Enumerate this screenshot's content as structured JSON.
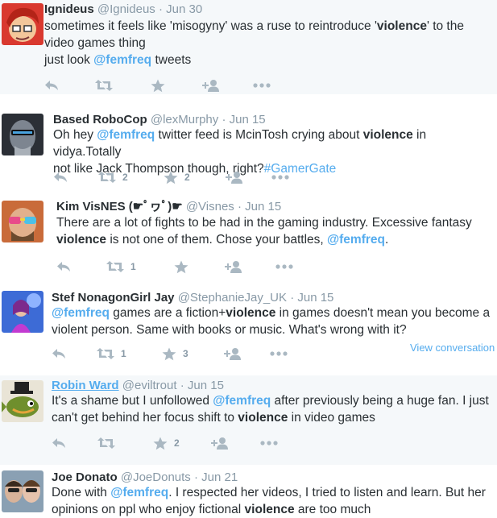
{
  "tweets": [
    {
      "name": "Ignideus",
      "handle": "@Ignideus",
      "date": "Jun 30",
      "lines": [
        [
          {
            "t": "sometimes it feels like 'misogyny' was a ruse to reintroduce '"
          },
          {
            "t": "violence",
            "s": "kw"
          },
          {
            "t": "' to the"
          }
        ],
        [
          {
            "t": "video games thing"
          }
        ],
        [
          {
            "t": "just look "
          },
          {
            "t": "@femfreq",
            "s": "mention"
          },
          {
            "t": " tweets"
          }
        ]
      ],
      "retweets": "",
      "likes": ""
    },
    {
      "name": "Based RoboCop",
      "handle": "@lexMurphy",
      "date": "Jun 15",
      "lines": [
        [
          {
            "t": "Oh hey "
          },
          {
            "t": "@femfreq",
            "s": "mention"
          },
          {
            "t": " twitter feed is McinTosh crying about "
          },
          {
            "t": "violence",
            "s": "kw"
          },
          {
            "t": " in vidya.Totally"
          }
        ],
        [
          {
            "t": "not like Jack Thompson though, right?"
          },
          {
            "t": "#GamerGate",
            "s": "hashtag"
          }
        ]
      ],
      "retweets": "2",
      "likes": "2"
    },
    {
      "name": "Kim VisNES (☛ﾟヮﾟ)☛",
      "handle": "@Visnes",
      "date": "Jun 15",
      "lines": [
        [
          {
            "t": "There are a lot of fights to be had in the gaming industry. Excessive fantasy"
          }
        ],
        [
          {
            "t": "violence",
            "s": "kw"
          },
          {
            "t": " is not one of them. Chose your battles, "
          },
          {
            "t": "@femfreq",
            "s": "mention"
          },
          {
            "t": "."
          }
        ]
      ],
      "retweets": "1",
      "likes": ""
    },
    {
      "name": "Stef NonagonGirl Jay",
      "handle": "@StephanieJay_UK",
      "date": "Jun 15",
      "lines": [
        [
          {
            "t": "@femfreq",
            "s": "mention"
          },
          {
            "t": " games are a fiction+"
          },
          {
            "t": "violence",
            "s": "kw"
          },
          {
            "t": " in games doesn't mean you become a"
          }
        ],
        [
          {
            "t": "violent person. Same with books or music. What's wrong with it?"
          }
        ]
      ],
      "retweets": "1",
      "likes": "3",
      "view_conversation": "View conversation"
    },
    {
      "name": "Robin Ward",
      "handle": "@eviltrout",
      "date": "Jun 15",
      "lines": [
        [
          {
            "t": "It's a shame but I unfollowed "
          },
          {
            "t": "@femfreq",
            "s": "mention"
          },
          {
            "t": " after previously being a huge fan. I just"
          }
        ],
        [
          {
            "t": "can't get behind her focus shift to "
          },
          {
            "t": "violence",
            "s": "kw"
          },
          {
            "t": " in video games"
          }
        ]
      ],
      "retweets": "",
      "likes": "2"
    },
    {
      "name": "Joe Donato",
      "handle": "@JoeDonuts",
      "date": "Jun 21",
      "lines": [
        [
          {
            "t": "Done with "
          },
          {
            "t": "@femfreq",
            "s": "mention"
          },
          {
            "t": ". I respected her videos, I tried to listen and learn. But her"
          }
        ],
        [
          {
            "t": "opinions on ppl who enjoy fictional "
          },
          {
            "t": "violence",
            "s": "kw"
          },
          {
            "t": " are too much"
          }
        ]
      ],
      "retweets": "",
      "likes": ""
    }
  ],
  "icons": [
    "reply-icon",
    "retweet-icon",
    "like-icon",
    "follow-icon",
    "more-icon"
  ],
  "colors": {
    "accent": "#55acee",
    "text": "#292f33",
    "muted": "#8899a6",
    "icon": "#aab8c2",
    "shade": "#f5f8fa"
  }
}
